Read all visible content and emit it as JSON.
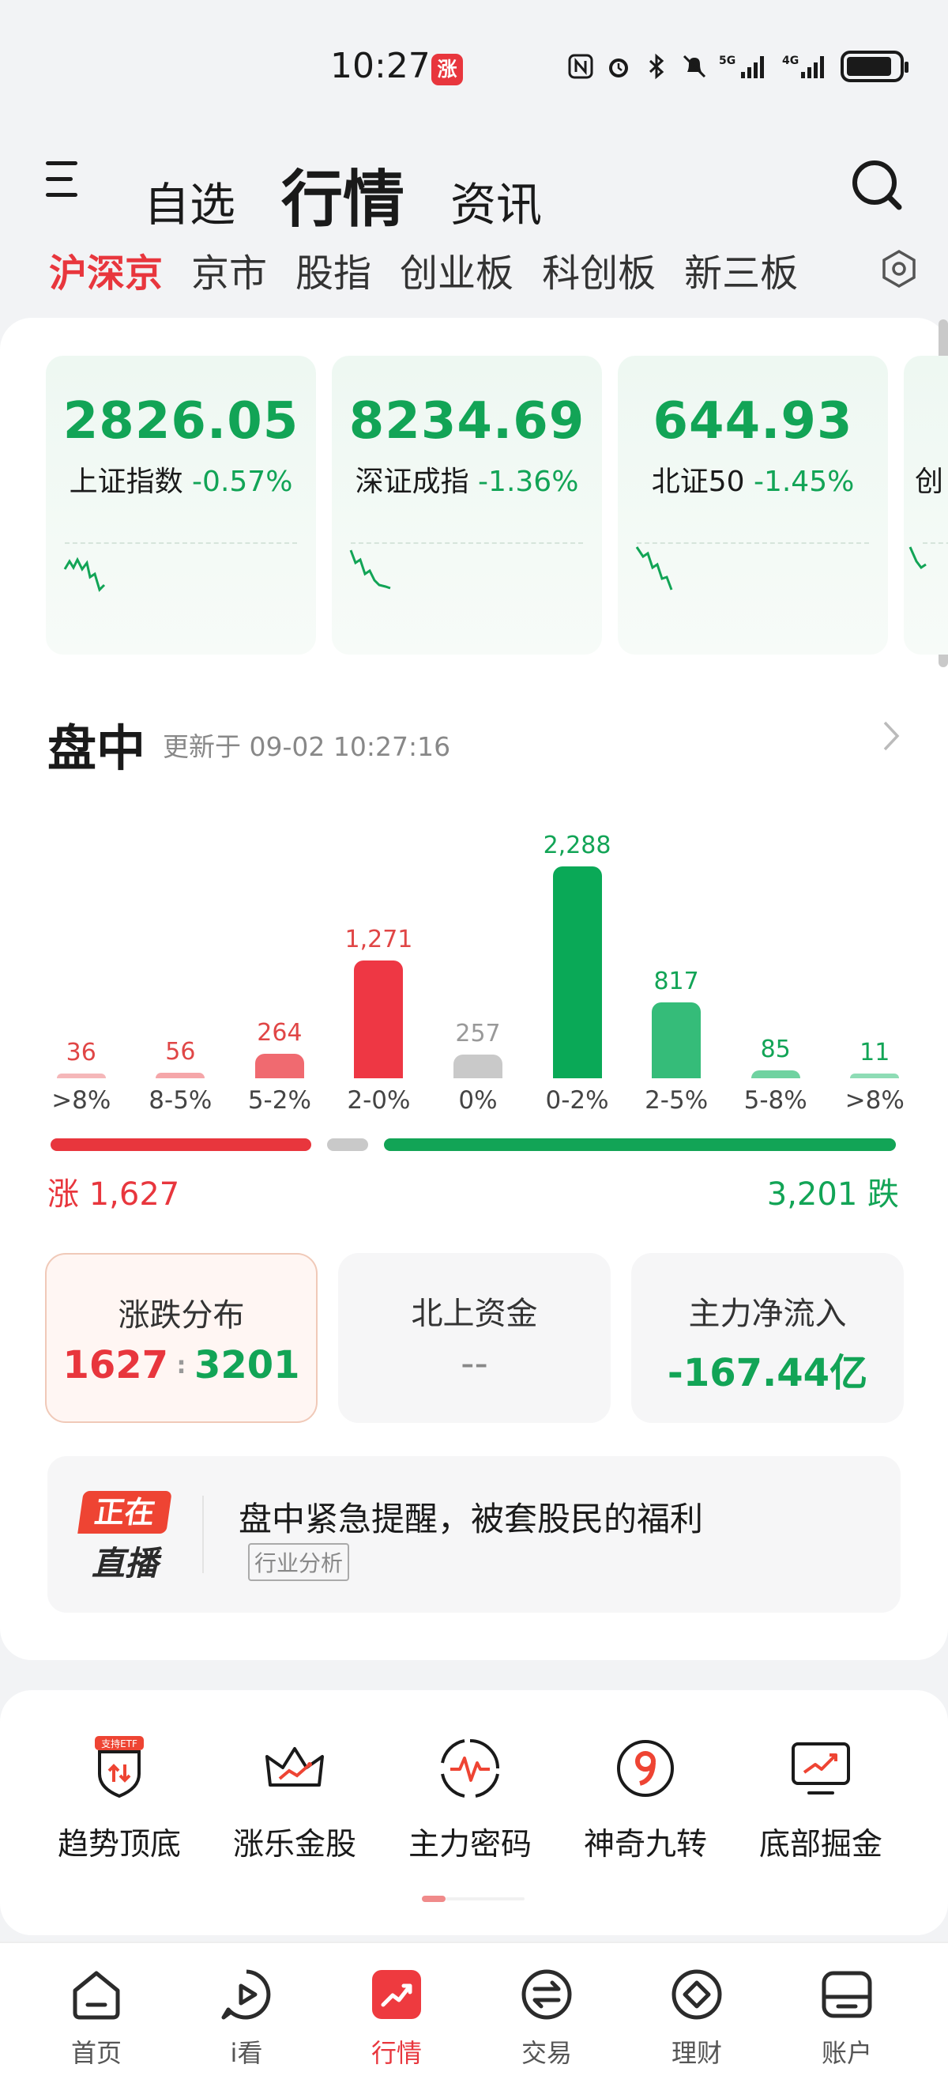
{
  "status_bar": {
    "time": "10:27",
    "badge": "涨",
    "sig5": "5G",
    "sig4": "4G"
  },
  "header": {
    "tabs": [
      "自选",
      "行情",
      "资讯"
    ],
    "active_tab": "行情"
  },
  "market_tabs": {
    "items": [
      "沪深京",
      "京市",
      "股指",
      "创业板",
      "科创板",
      "新三板"
    ],
    "active": "沪深京"
  },
  "indices": [
    {
      "value": "2826.05",
      "name": "上证指数",
      "change": "-0.57%"
    },
    {
      "value": "8234.69",
      "name": "深证成指",
      "change": "-1.36%"
    },
    {
      "value": "644.93",
      "name": "北证50",
      "change": "-1.45%"
    },
    {
      "value": "",
      "name": "创",
      "change": ""
    }
  ],
  "intraday": {
    "title": "盘中",
    "updated": "更新于 09-02 10:27:16"
  },
  "chart_data": {
    "type": "bar",
    "categories": [
      ">8%",
      "8-5%",
      "5-2%",
      "2-0%",
      "0%",
      "0-2%",
      "2-5%",
      "5-8%",
      ">8%"
    ],
    "values": [
      36,
      56,
      264,
      1271,
      257,
      2288,
      817,
      85,
      11
    ],
    "labels": [
      "36",
      "56",
      "264",
      "1,271",
      "257",
      "2,288",
      "817",
      "85",
      "11"
    ],
    "colors": [
      "#f5b7b9",
      "#f5a6a9",
      "#f06a70",
      "#ee3744",
      "#c9c9c9",
      "#0aa957",
      "#35bc79",
      "#6fd2a0",
      "#8edcb5"
    ],
    "label_colors": [
      "#e04646",
      "#e04646",
      "#e04646",
      "#e04646",
      "#999999",
      "#12a456",
      "#12a456",
      "#12a456",
      "#12a456"
    ]
  },
  "ratio": {
    "rise": 1627,
    "flat": 257,
    "fall": 3201,
    "rise_label": "涨 1,627",
    "fall_label": "3,201 跌"
  },
  "stats": [
    {
      "label": "涨跌分布",
      "up": "1627",
      "down": "3201"
    },
    {
      "label": "北上资金",
      "value": "--"
    },
    {
      "label": "主力净流入",
      "value": "-167.44亿"
    }
  ],
  "live": {
    "badge_top": "正在",
    "badge_bottom": "直播",
    "title": "盘中紧急提醒，被套股民的福利",
    "tag": "行业分析"
  },
  "tools": [
    {
      "label": "趋势顶底",
      "icon": "trend-shield-icon",
      "badge": "支持ETF"
    },
    {
      "label": "涨乐金股",
      "icon": "crown-icon"
    },
    {
      "label": "主力密码",
      "icon": "pulse-target-icon"
    },
    {
      "label": "神奇九转",
      "icon": "number-nine-icon"
    },
    {
      "label": "底部掘金",
      "icon": "monitor-chart-icon"
    }
  ],
  "bottom_nav": [
    {
      "label": "首页",
      "icon": "home-icon"
    },
    {
      "label": "i看",
      "icon": "play-icon"
    },
    {
      "label": "行情",
      "icon": "market-icon"
    },
    {
      "label": "交易",
      "icon": "exchange-icon"
    },
    {
      "label": "理财",
      "icon": "wealth-icon"
    },
    {
      "label": "账户",
      "icon": "account-icon"
    }
  ],
  "bottom_nav_active": "行情",
  "colors": {
    "rise": "#e8363d",
    "fall": "#12a456",
    "flat": "#c9c9c9"
  }
}
